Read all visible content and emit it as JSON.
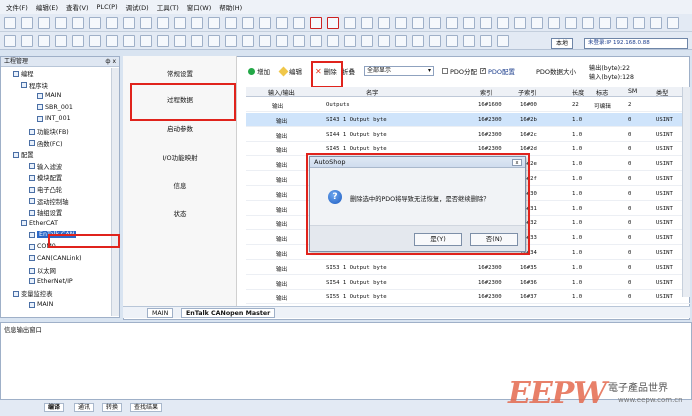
{
  "menu": [
    "文件(F)",
    "编辑(E)",
    "查看(V)",
    "PLC(P)",
    "调试(D)",
    "工具(T)",
    "窗口(W)",
    "帮助(H)"
  ],
  "toolbar": {
    "local_label": "本地",
    "login_label": "未登录:IP 192.168.0.88"
  },
  "project_panel": {
    "title": "工程管理",
    "pin": "ф x",
    "tree": [
      {
        "label": "编程",
        "indent": 1
      },
      {
        "label": "程序块",
        "indent": 2
      },
      {
        "label": "MAIN",
        "indent": 4
      },
      {
        "label": "SBR_001",
        "indent": 4
      },
      {
        "label": "INT_001",
        "indent": 4
      },
      {
        "label": "功能块(FB)",
        "indent": 3
      },
      {
        "label": "函数(FC)",
        "indent": 3
      },
      {
        "label": "配置",
        "indent": 1
      },
      {
        "label": "输入滤波",
        "indent": 3
      },
      {
        "label": "模块配置",
        "indent": 3
      },
      {
        "label": "电子凸轮",
        "indent": 3
      },
      {
        "label": "运动控制轴",
        "indent": 3
      },
      {
        "label": "轴组设置",
        "indent": 3
      },
      {
        "label": "EtherCAT",
        "indent": 2
      },
      {
        "label": "EnTalk CAN",
        "indent": 3
      },
      {
        "label": "COM0",
        "indent": 3
      },
      {
        "label": "CAN(CANLink)",
        "indent": 3
      },
      {
        "label": "以太网",
        "indent": 3
      },
      {
        "label": "EtherNet/IP",
        "indent": 3
      },
      {
        "label": "变量监控表",
        "indent": 1
      },
      {
        "label": "MAIN",
        "indent": 3
      }
    ]
  },
  "left_nav": [
    "常规设置",
    "过程数据",
    "启动参数",
    "I/O功能映射",
    "信息",
    "状态"
  ],
  "actions": {
    "add": "增加",
    "edit": "编辑",
    "delete": "删除",
    "fold": "折叠",
    "filter_value": "全部显示",
    "pdo_alloc": "PDO分配",
    "pdo_config": "PDO配置",
    "pdo_size": "PDO数据大小",
    "output_bytes": "输出(byte):22",
    "input_bytes": "输入(byte):128"
  },
  "table": {
    "headers": [
      "输入/输出",
      "名字",
      "索引",
      "子索引",
      "长度",
      "标志",
      "SM",
      "类型"
    ],
    "rows": [
      [
        "输出",
        "Outputs",
        "16#1600",
        "16#00",
        "22",
        "可编辑",
        "2",
        ""
      ],
      [
        "输出",
        "SI43 1 Output byte",
        "16#2300",
        "16#2b",
        "1.0",
        "",
        "0",
        "USINT"
      ],
      [
        "输出",
        "SI44 1 Output byte",
        "16#2300",
        "16#2c",
        "1.0",
        "",
        "0",
        "USINT"
      ],
      [
        "输出",
        "SI45 1 Output byte",
        "16#2300",
        "16#2d",
        "1.0",
        "",
        "0",
        "USINT"
      ],
      [
        "输出",
        "",
        "",
        "16#2e",
        "1.0",
        "",
        "0",
        "USINT"
      ],
      [
        "输出",
        "",
        "",
        "16#2f",
        "1.0",
        "",
        "0",
        "USINT"
      ],
      [
        "输出",
        "",
        "",
        "16#30",
        "1.0",
        "",
        "0",
        "USINT"
      ],
      [
        "输出",
        "",
        "",
        "16#31",
        "1.0",
        "",
        "0",
        "USINT"
      ],
      [
        "输出",
        "",
        "",
        "16#32",
        "1.0",
        "",
        "0",
        "USINT"
      ],
      [
        "输出",
        "",
        "",
        "16#33",
        "1.0",
        "",
        "0",
        "USINT"
      ],
      [
        "输出",
        "",
        "",
        "16#34",
        "1.0",
        "",
        "0",
        "USINT"
      ],
      [
        "输出",
        "SI53 1 Output byte",
        "16#2300",
        "16#35",
        "1.0",
        "",
        "0",
        "USINT"
      ],
      [
        "输出",
        "SI54 1 Output byte",
        "16#2300",
        "16#36",
        "1.0",
        "",
        "0",
        "USINT"
      ],
      [
        "输出",
        "SI55 1 Output byte",
        "16#2300",
        "16#37",
        "1.0",
        "",
        "0",
        "USINT"
      ]
    ]
  },
  "dialog": {
    "title": "AutoShop",
    "close": "x",
    "message": "删除选中的PDO将导致无法恢复，是否继续删除？",
    "yes": "是(Y)",
    "no": "否(N)"
  },
  "bottom_tabs": [
    "MAIN",
    "EnTalk CANopen Master"
  ],
  "info_panel": {
    "title": "信息输出窗口"
  },
  "status_tabs": [
    "编译",
    "通讯",
    "转换",
    "查找结果"
  ],
  "watermark": {
    "logo": "EEPW",
    "cn": "電子產品世界",
    "url": "www.eepw.com.cn"
  }
}
